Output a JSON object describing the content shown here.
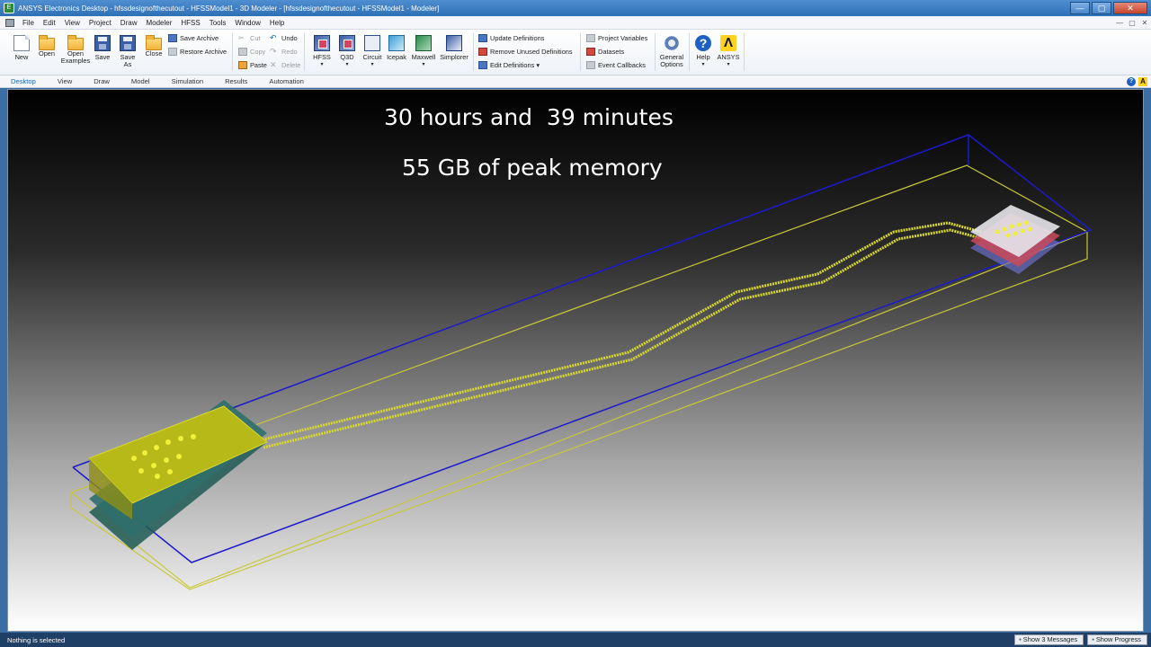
{
  "window": {
    "title": "ANSYS Electronics Desktop - hfssdesignofthecutout - HFSSModel1 - 3D Modeler - [hfssdesignofthecutout - HFSSModel1 - Modeler]",
    "app_icon": "ansys-edt-icon",
    "controls": {
      "minimize": "—",
      "maximize": "▢",
      "close": "✕"
    }
  },
  "menu": {
    "items": [
      "File",
      "Edit",
      "View",
      "Project",
      "Draw",
      "Modeler",
      "HFSS",
      "Tools",
      "Window",
      "Help"
    ],
    "mdi_controls": [
      "—",
      "▢",
      "✕"
    ]
  },
  "ribbon": {
    "file_group": [
      {
        "label": "New",
        "icon": "new-document-icon"
      },
      {
        "label": "Open",
        "icon": "open-folder-icon"
      },
      {
        "label": "Open\nExamples",
        "icon": "open-examples-icon"
      },
      {
        "label": "Save",
        "icon": "save-icon"
      },
      {
        "label": "Save\nAs",
        "icon": "save-as-icon"
      },
      {
        "label": "Close",
        "icon": "close-folder-icon"
      }
    ],
    "archive_group": {
      "save_archive": "Save Archive",
      "restore_archive": "Restore Archive"
    },
    "edit_group": {
      "cut": "Cut",
      "copy": "Copy",
      "paste": "Paste",
      "undo": "Undo",
      "redo": "Redo",
      "delete": "Delete"
    },
    "design_group": [
      {
        "label": "HFSS",
        "icon": "hfss-icon",
        "dropdown": true
      },
      {
        "label": "Q3D",
        "icon": "q3d-icon",
        "dropdown": true
      },
      {
        "label": "Circuit",
        "icon": "circuit-icon",
        "dropdown": true
      },
      {
        "label": "Icepak",
        "icon": "icepak-icon",
        "dropdown": false
      },
      {
        "label": "Maxwell",
        "icon": "maxwell-icon",
        "dropdown": true
      },
      {
        "label": "Simplorer",
        "icon": "simplorer-icon",
        "dropdown": false
      }
    ],
    "definitions_group": {
      "update": "Update Definitions",
      "remove_unused": "Remove Unused Definitions",
      "edit": "Edit Definitions ▾"
    },
    "variables_group": {
      "project_variables": "Project Variables",
      "datasets": "Datasets",
      "event_callbacks": "Event Callbacks"
    },
    "general_options": "General\nOptions",
    "help": "Help",
    "ansys": "ANSYS",
    "dropdown_glyph": "▾"
  },
  "tabs": [
    "Desktop",
    "View",
    "Draw",
    "Model",
    "Simulation",
    "Results",
    "Automation"
  ],
  "active_tab": "Desktop",
  "tab_right": {
    "help": "?",
    "ansys": "A"
  },
  "viewport": {
    "overlay_line1": "30 hours and  39 minutes",
    "overlay_line2": "55 GB of peak memory",
    "colors": {
      "region_outline": "#1a1acc",
      "substrate_outline": "#c8c83a",
      "trace": "#d8d830",
      "package_fill": "#c2c418"
    }
  },
  "status": {
    "message": "Nothing is selected",
    "show_messages": "Show 3 Messages",
    "show_progress": "Show Progress"
  }
}
